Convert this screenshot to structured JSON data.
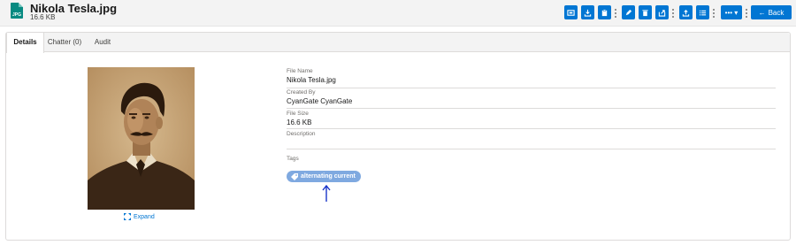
{
  "header": {
    "file_type_icon_label": "JPG",
    "title": "Nikola Tesla.jpg",
    "size": "16.6 KB"
  },
  "toolbar": {
    "buttons": [
      {
        "name": "preview-icon"
      },
      {
        "name": "download-icon"
      },
      {
        "name": "clipboard-icon"
      },
      {
        "name": "edit-icon"
      },
      {
        "name": "delete-icon"
      },
      {
        "name": "share-icon"
      },
      {
        "name": "upload-icon"
      },
      {
        "name": "list-icon"
      }
    ],
    "more_label": "•••  ▾",
    "back_label": "Back",
    "back_arrow": "←"
  },
  "tabs": [
    {
      "label": "Details",
      "active": true
    },
    {
      "label": "Chatter (0)",
      "active": false
    },
    {
      "label": "Audit",
      "active": false
    }
  ],
  "preview": {
    "expand_label": "Expand"
  },
  "fields": [
    {
      "label": "File Name",
      "value": "Nikola Tesla.jpg"
    },
    {
      "label": "Created By",
      "value": "CyanGate CyanGate"
    },
    {
      "label": "File Size",
      "value": "16.6 KB"
    },
    {
      "label": "Description",
      "value": ""
    },
    {
      "label": "Tags",
      "value": ""
    }
  ],
  "tags": [
    "alternating current"
  ],
  "colors": {
    "brand": "#0176d3",
    "tag": "#7fa9e0",
    "file_icon": "#088a81",
    "annotation_arrow": "#1a35c9"
  }
}
